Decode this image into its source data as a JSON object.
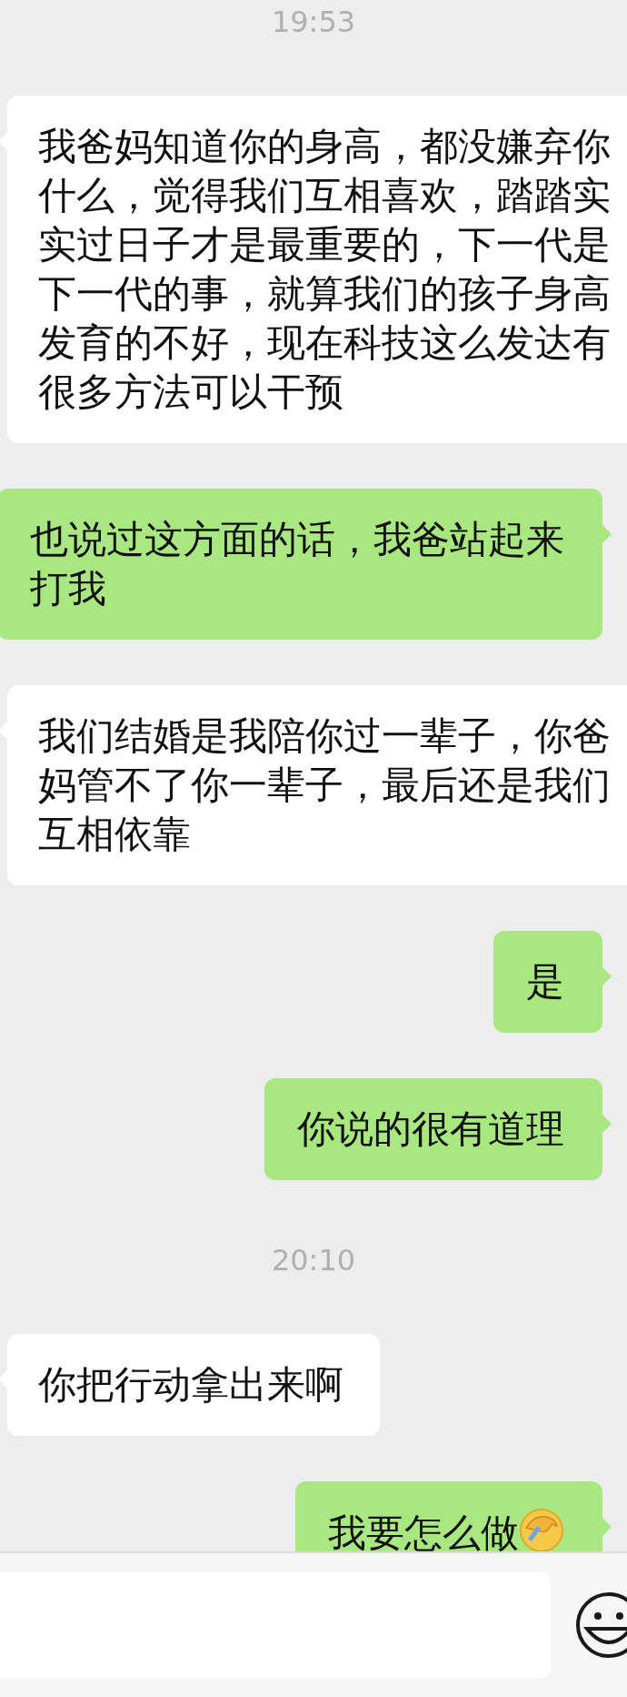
{
  "messages": [
    {
      "kind": "time",
      "text": "19:53"
    },
    {
      "kind": "received",
      "text": "我爸妈知道你的身高，都没嫌弃你什么，觉得我们互相喜欢，踏踏实实过日子才是最重要的，下一代是下一代的事，就算我们的孩子身高发育的不好，现在科技这么发达有很多方法可以干预",
      "emoji": false
    },
    {
      "kind": "sent",
      "lines": [
        "也说过这方面的话，我爸站起来",
        "打我"
      ],
      "emoji": false
    },
    {
      "kind": "received",
      "text": "我们结婚是我陪你过一辈子，你爸妈管不了你一辈子，最后还是我们互相依靠",
      "emoji": false
    },
    {
      "kind": "sent",
      "text": "是",
      "emoji": false
    },
    {
      "kind": "sent",
      "text": "你说的很有道理",
      "emoji": false
    },
    {
      "kind": "time",
      "text": "20:10"
    },
    {
      "kind": "received",
      "text": "你把行动拿出来啊",
      "emoji": false
    },
    {
      "kind": "sent",
      "text": "我要怎么做",
      "emoji": true
    }
  ]
}
